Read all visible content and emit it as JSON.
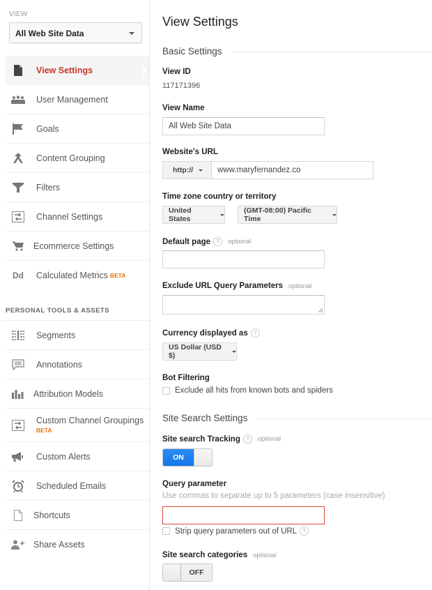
{
  "sidebar": {
    "view_label": "VIEW",
    "view_selected": "All Web Site Data",
    "items": [
      {
        "label": "View Settings",
        "icon": "document-icon",
        "active": true
      },
      {
        "label": "User Management",
        "icon": "users-icon"
      },
      {
        "label": "Goals",
        "icon": "flag-icon"
      },
      {
        "label": "Content Grouping",
        "icon": "merge-icon"
      },
      {
        "label": "Filters",
        "icon": "filter-icon"
      },
      {
        "label": "Channel Settings",
        "icon": "channel-icon"
      },
      {
        "label": "Ecommerce Settings",
        "icon": "cart-icon"
      },
      {
        "label": "Calculated Metrics",
        "icon": "dd-icon",
        "badge": "BETA"
      }
    ],
    "personal_header": "PERSONAL TOOLS & ASSETS",
    "personal_items": [
      {
        "label": "Segments",
        "icon": "segments-icon"
      },
      {
        "label": "Annotations",
        "icon": "comment-icon"
      },
      {
        "label": "Attribution Models",
        "icon": "bar-chart-icon"
      },
      {
        "label": "Custom Channel Groupings",
        "icon": "channel-icon",
        "badge": "BETA"
      },
      {
        "label": "Custom Alerts",
        "icon": "megaphone-icon"
      },
      {
        "label": "Scheduled Emails",
        "icon": "alarm-clock-icon"
      },
      {
        "label": "Shortcuts",
        "icon": "shortcut-doc-icon"
      },
      {
        "label": "Share Assets",
        "icon": "add-user-icon"
      }
    ]
  },
  "main": {
    "title": "View Settings",
    "basic_settings": "Basic Settings",
    "view_id_label": "View ID",
    "view_id": "117171396",
    "view_name_label": "View Name",
    "view_name": "All Web Site Data",
    "url_label": "Website's URL",
    "url_protocol": "http://",
    "url_value": "www.maryfernandez.co",
    "timezone_label": "Time zone country or territory",
    "timezone_country": "United States",
    "timezone_value": "(GMT-08:00) Pacific Time",
    "default_page_label": "Default page",
    "default_page_value": "",
    "optional": "optional",
    "help": "?",
    "exclude_label": "Exclude URL Query Parameters",
    "exclude_value": "",
    "currency_label": "Currency displayed as",
    "currency_value": "US Dollar (USD $)",
    "bot_label": "Bot Filtering",
    "bot_checkbox": "Exclude all hits from known bots and spiders",
    "bot_checked": false,
    "site_search_settings": "Site Search Settings",
    "site_search_tracking_label": "Site search Tracking",
    "site_search_tracking_state": "ON",
    "query_param_label": "Query parameter",
    "query_param_hint": "Use commas to separate up to 5 parameters (case insensitive)",
    "query_param_value": "",
    "strip_label": "Strip query parameters out of URL",
    "strip_checked": false,
    "categories_label": "Site search categories",
    "categories_state": "OFF"
  }
}
